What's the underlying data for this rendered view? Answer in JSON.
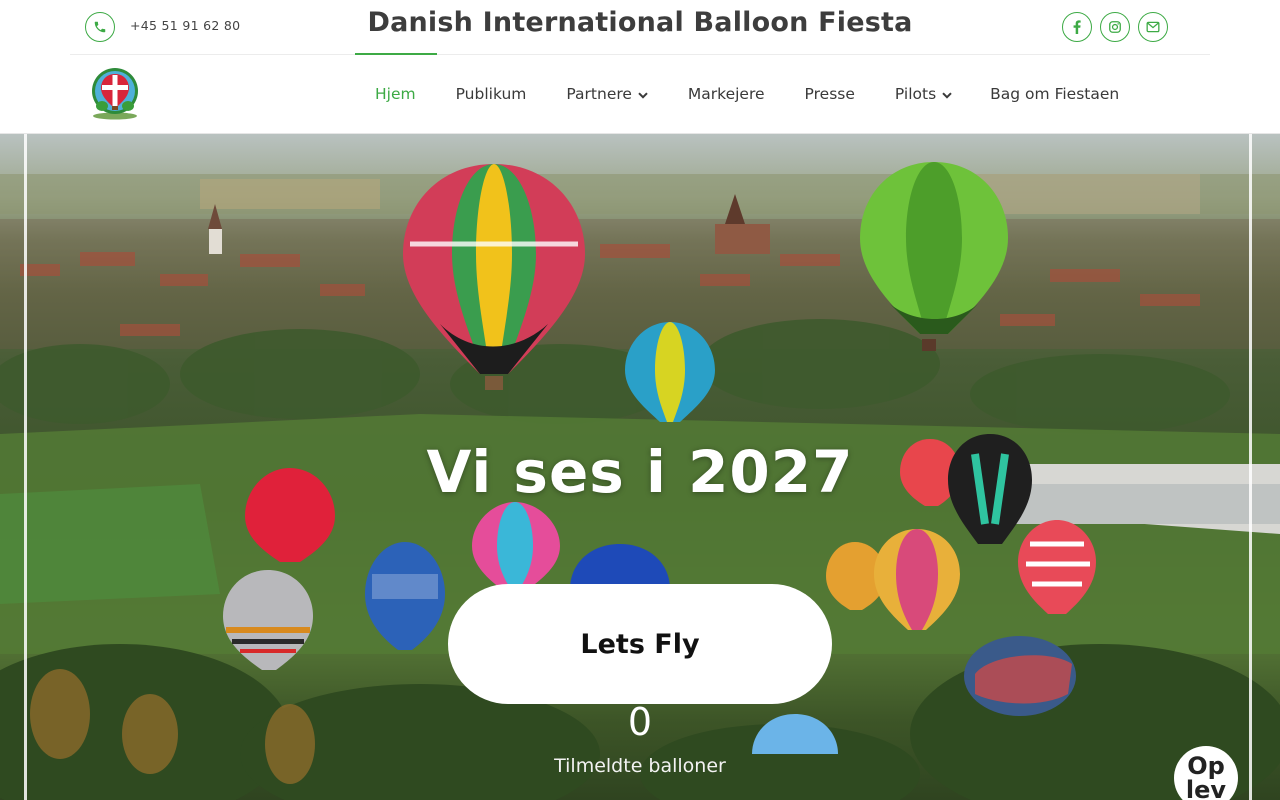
{
  "header": {
    "phone": "+45 51 91 62 80",
    "site_title": "Danish International Balloon Fiesta",
    "social": [
      {
        "name": "facebook-icon"
      },
      {
        "name": "instagram-icon"
      },
      {
        "name": "email-icon"
      }
    ],
    "accent_color": "#3daa45"
  },
  "nav": {
    "items": [
      {
        "label": "Hjem",
        "active": true,
        "has_dropdown": false
      },
      {
        "label": "Publikum",
        "active": false,
        "has_dropdown": false
      },
      {
        "label": "Partnere",
        "active": false,
        "has_dropdown": true
      },
      {
        "label": "Markejere",
        "active": false,
        "has_dropdown": false
      },
      {
        "label": "Presse",
        "active": false,
        "has_dropdown": false
      },
      {
        "label": "Pilots",
        "active": false,
        "has_dropdown": true
      },
      {
        "label": "Bag om Fiestaen",
        "active": false,
        "has_dropdown": false
      }
    ]
  },
  "hero": {
    "heading": "Vi ses i 2027",
    "cta_label": "Lets Fly",
    "counter_value": "0",
    "counter_label": "Tilmeldte balloner",
    "badge_line1": "Op",
    "badge_line2": "lev"
  }
}
